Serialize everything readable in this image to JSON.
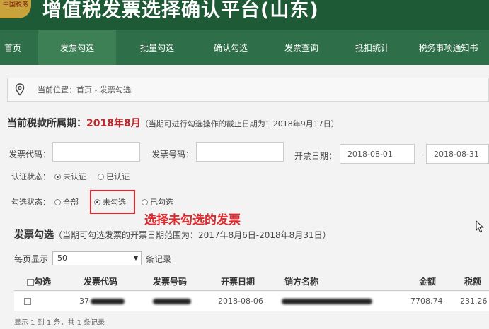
{
  "header": {
    "logo_text": "中国税务",
    "title": "增值税发票选择确认平台(山东)"
  },
  "nav": {
    "items": [
      {
        "label": "首页",
        "active": false
      },
      {
        "label": "发票勾选",
        "active": true
      },
      {
        "label": "批量勾选",
        "active": false
      },
      {
        "label": "确认勾选",
        "active": false
      },
      {
        "label": "发票查询",
        "active": false
      },
      {
        "label": "抵扣统计",
        "active": false
      },
      {
        "label": "税务事项通知书",
        "active": false
      }
    ]
  },
  "breadcrumb": {
    "text": "当前位置：首页 - 发票勾选"
  },
  "period": {
    "label": "当前税款所属期：",
    "value": "2018年8月",
    "note": "（当期可进行勾选操作的截止日期为：2018年9月17日）"
  },
  "filters": {
    "invoice_code_label": "发票代码：",
    "invoice_code_value": "",
    "invoice_number_label": "发票号码：",
    "invoice_number_value": "",
    "date_label": "开票日期：",
    "date_from": "2018-08-01",
    "date_sep": "-",
    "date_to": "2018-08-31",
    "auth_status_label": "认证状态：",
    "auth_options": [
      {
        "label": "未认证",
        "checked": true
      },
      {
        "label": "已认证",
        "checked": false
      }
    ],
    "select_status_label": "勾选状态：",
    "select_options": [
      {
        "label": "全部",
        "checked": false
      },
      {
        "label": "未勾选",
        "checked": true
      },
      {
        "label": "已勾选",
        "checked": false
      }
    ]
  },
  "annotation": {
    "text": "选择未勾选的发票",
    "color": "#e0282d"
  },
  "list": {
    "title": "发票勾选",
    "note": "（当期可勾选发票的开票日期范围为：2017年8月6日-2018年8月31日）",
    "page_size_prefix": "每页显示",
    "page_size_value": "50",
    "page_size_suffix": "条记录",
    "columns": [
      "勾选",
      "发票代码",
      "发票号码",
      "开票日期",
      "销方名称",
      "金额",
      "税额"
    ],
    "rows": [
      {
        "checked": false,
        "code": "37",
        "number": "",
        "date": "2018-08-06",
        "seller": "",
        "amount": "7708.74",
        "tax": "231.26"
      }
    ],
    "footer": "显示 1 到 1 条，共 1 条记录"
  },
  "colors": {
    "header_bg": "#1d5a35",
    "nav_bg": "#2e6e49",
    "nav_active_bg": "#3d8056",
    "highlight": "#c0262c"
  }
}
